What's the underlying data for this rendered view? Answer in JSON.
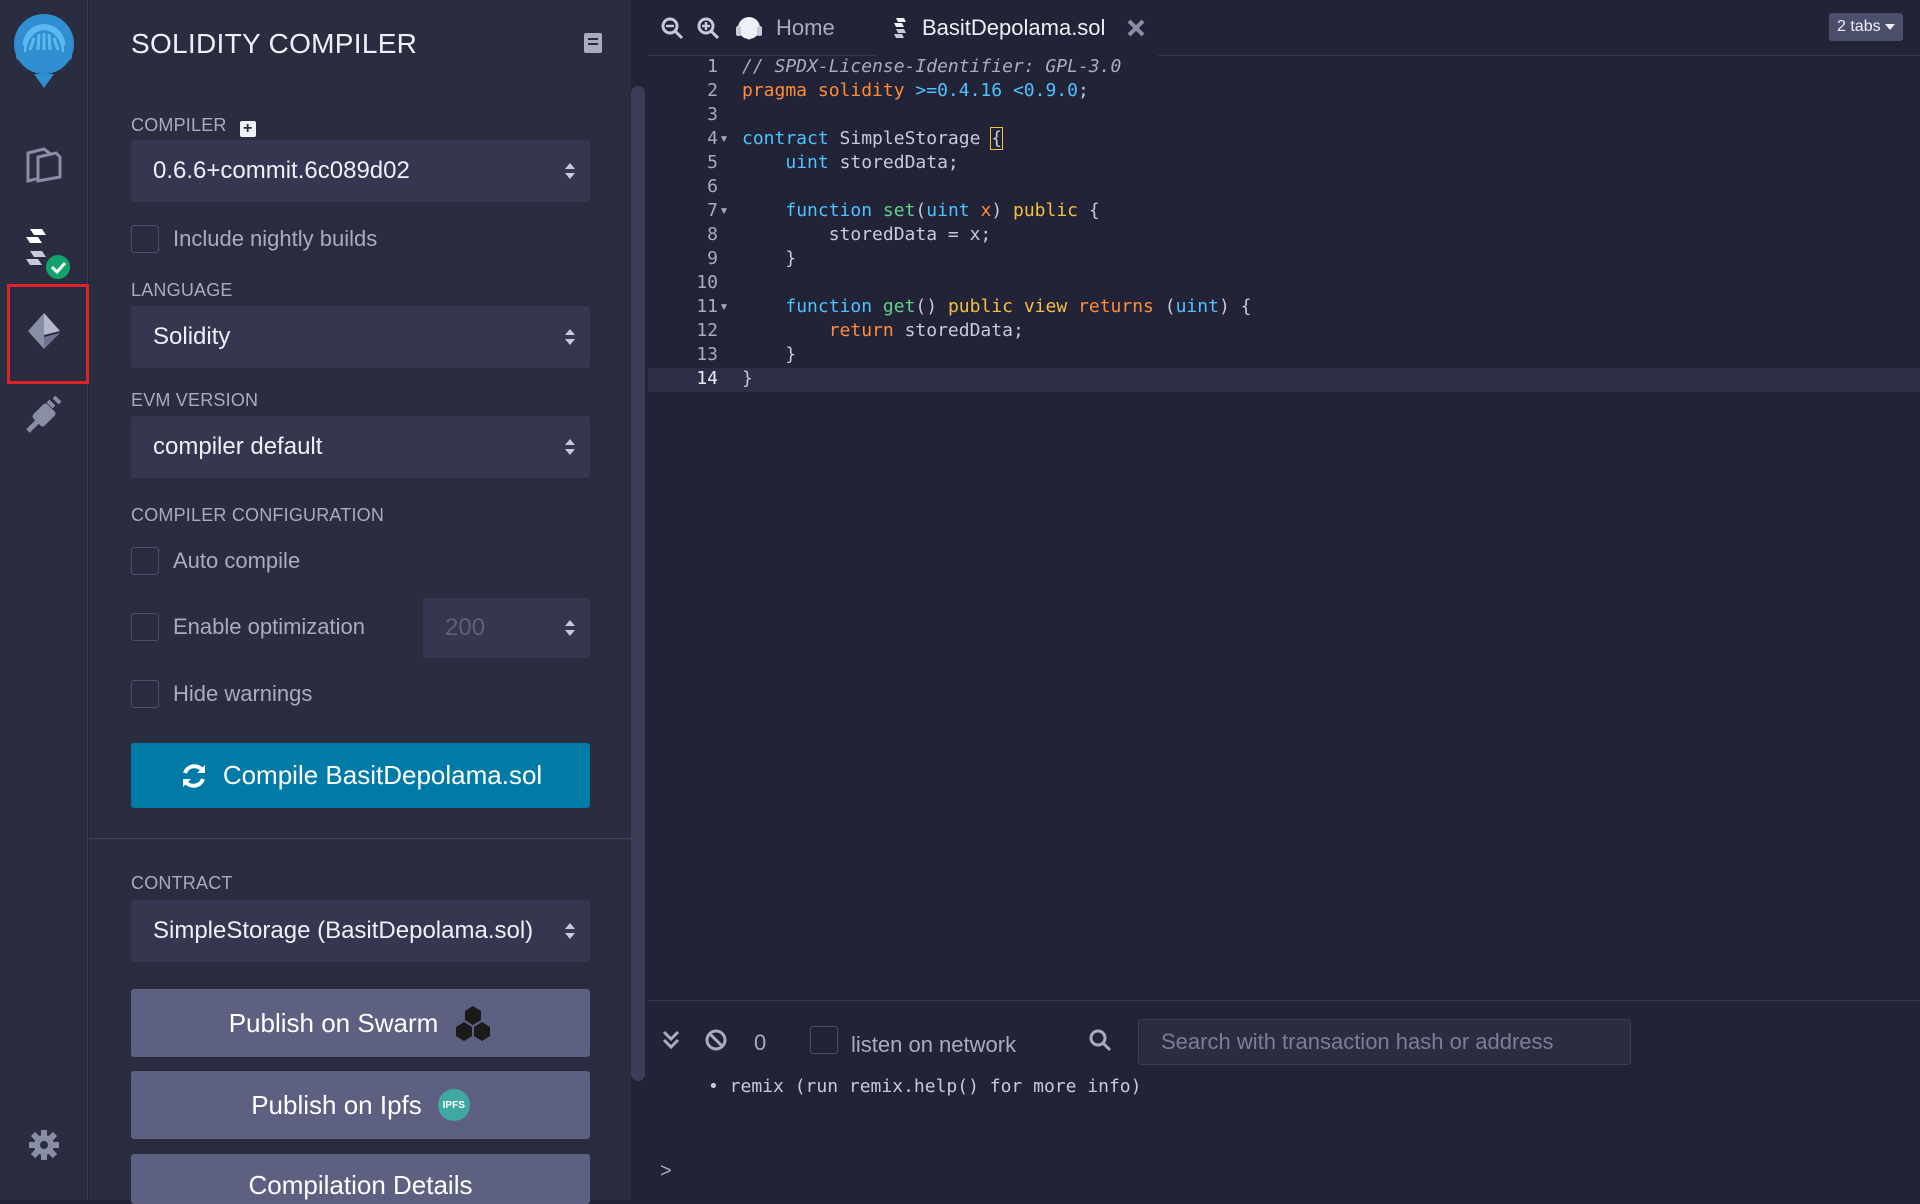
{
  "panel": {
    "title": "SOLIDITY COMPILER",
    "compiler_label": "COMPILER",
    "compiler_version": "0.6.6+commit.6c089d02",
    "nightly_label": "Include nightly builds",
    "language_label": "LANGUAGE",
    "language_value": "Solidity",
    "evm_label": "EVM VERSION",
    "evm_value": "compiler default",
    "config_label": "COMPILER CONFIGURATION",
    "auto_compile_label": "Auto compile",
    "optimization_label": "Enable optimization",
    "optimization_runs": "200",
    "hide_warnings_label": "Hide warnings",
    "compile_button": "Compile BasitDepolama.sol",
    "contract_label": "CONTRACT",
    "contract_value": "SimpleStorage (BasitDepolama.sol)",
    "publish_swarm": "Publish on Swarm",
    "publish_ipfs": "Publish on Ipfs",
    "ipfs_badge": "IPFS",
    "compilation_details": "Compilation Details"
  },
  "tabs": {
    "home": "Home",
    "active_file": "BasitDepolama.sol",
    "count": "2 tabs"
  },
  "editor": {
    "line_numbers": [
      "1",
      "2",
      "3",
      "4",
      "5",
      "6",
      "7",
      "8",
      "9",
      "10",
      "11",
      "12",
      "13",
      "14"
    ],
    "lines": {
      "l1": "// SPDX-License-Identifier: GPL-3.0",
      "l2_kw": "pragma solidity",
      "l2_ver": ">=0.4.16 <0.9.0",
      "l2_end": ";",
      "l4_kw": "contract",
      "l4_name": "SimpleStorage",
      "l4_brace": "{",
      "l5_type": "uint",
      "l5_rest": "storedData;",
      "l7_kw": "function",
      "l7_name": "set",
      "l7_open": "(",
      "l7_type": "uint",
      "l7_var": "x",
      "l7_close": ")",
      "l7_pub": "public",
      "l7_brace": "{",
      "l8": "storedData = x;",
      "l9": "}",
      "l11_kw": "function",
      "l11_name": "get",
      "l11_paren": "()",
      "l11_pub": "public",
      "l11_view": "view",
      "l11_ret": "returns",
      "l11_open": "(",
      "l11_type": "uint",
      "l11_close": ") {",
      "l12_ret": "return",
      "l12_rest": "storedData;",
      "l13": "}",
      "l14": "}"
    }
  },
  "terminal": {
    "count": "0",
    "listen_label": "listen on network",
    "search_placeholder": "Search with transaction hash or address",
    "output": "• remix (run remix.help() for more info)",
    "prompt": ">"
  }
}
